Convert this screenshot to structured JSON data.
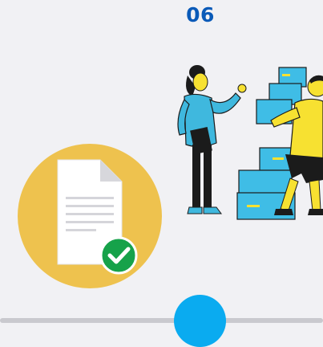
{
  "step": {
    "number": "06"
  },
  "colors": {
    "background": "#f1f1f4",
    "step_number": "#0a5ab8",
    "badge_circle": "#eec24e",
    "check": "#16a24a",
    "timeline_line": "#c9c9ce",
    "timeline_dot": "#0aabf0",
    "box_blue": "#3fbde6",
    "shirt_yellow": "#f7e131",
    "sweater_blue": "#3fb8de"
  },
  "icons": {
    "document": "document-icon",
    "check": "check-circle-icon",
    "illustration": "people-moving-boxes-illustration"
  }
}
